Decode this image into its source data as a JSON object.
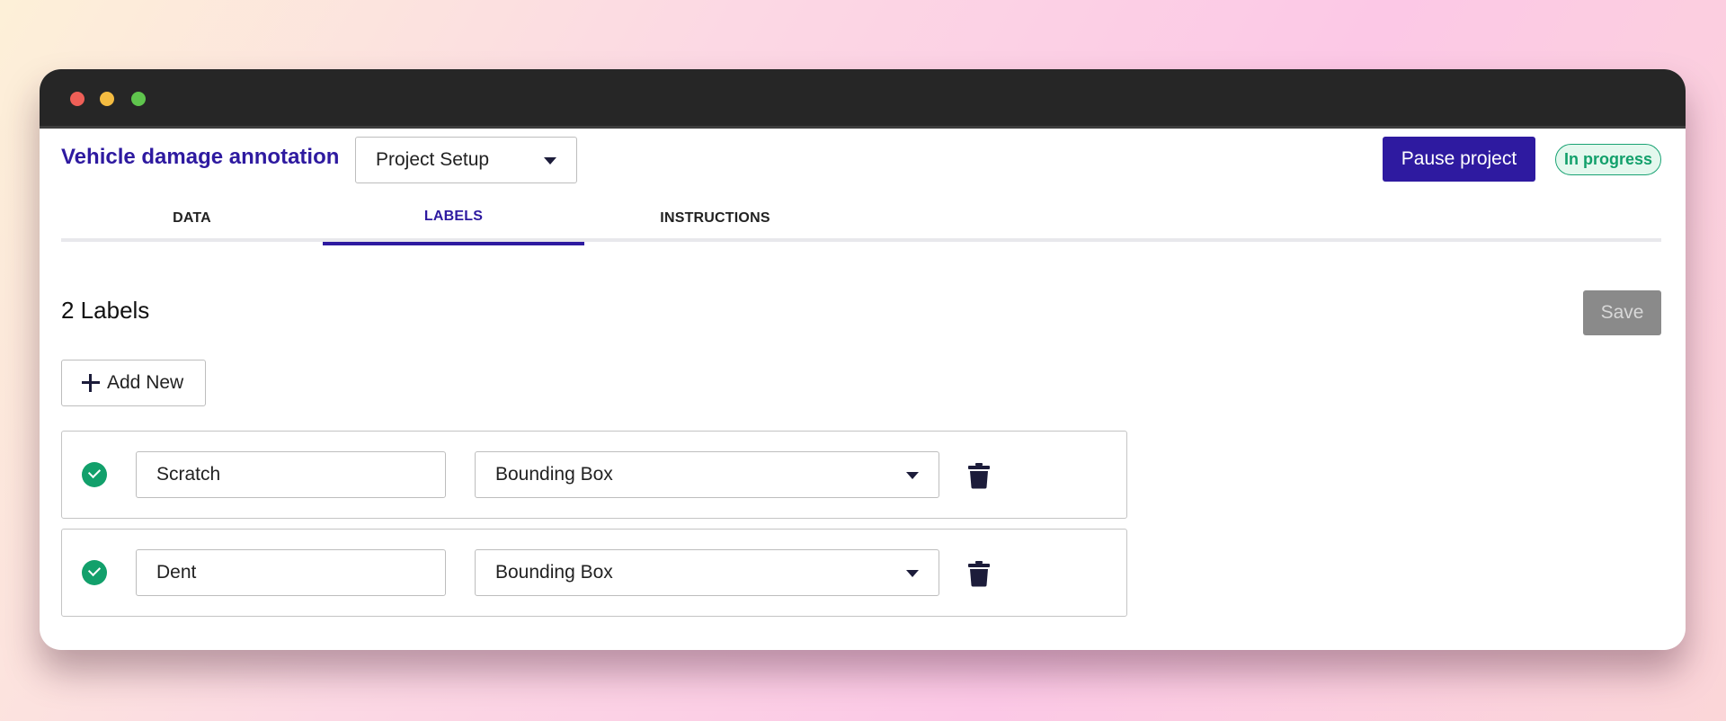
{
  "header": {
    "project_title": "Vehicle damage annotation",
    "stage_select": "Project Setup",
    "pause_label": "Pause project",
    "status": "In progress"
  },
  "tabs": [
    {
      "label": "DATA",
      "active": false
    },
    {
      "label": "LABELS",
      "active": true
    },
    {
      "label": "INSTRUCTIONS",
      "active": false
    }
  ],
  "labels_section": {
    "count_title": "2 Labels",
    "save_label": "Save",
    "add_label": "Add New",
    "items": [
      {
        "name": "Scratch",
        "type": "Bounding Box"
      },
      {
        "name": "Dent",
        "type": "Bounding Box"
      }
    ]
  },
  "icons": {
    "check": "check-circle-icon",
    "trash": "trash-icon",
    "plus": "plus-icon",
    "caret": "caret-down-icon"
  },
  "colors": {
    "brand": "#2e1aa0",
    "success": "#12a06b",
    "disabled": "#8a8a8a",
    "titlebar": "#262626"
  }
}
